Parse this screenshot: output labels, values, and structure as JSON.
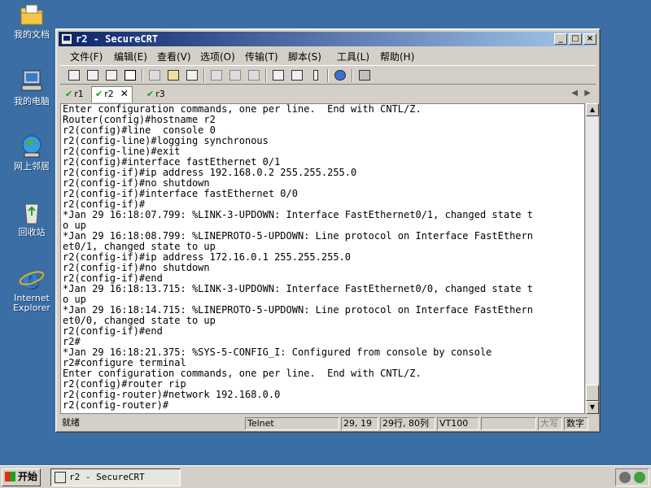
{
  "desktop": {
    "icons": [
      {
        "label": "我的文档"
      },
      {
        "label": "我的电脑"
      },
      {
        "label": "网上邻居"
      },
      {
        "label": "回收站"
      },
      {
        "label": "Internet Explorer"
      }
    ]
  },
  "window": {
    "title": "r2 - SecureCRT",
    "controls": {
      "minimize": "_",
      "maximize": "□",
      "close": "×"
    }
  },
  "menu": [
    "文件(F)",
    "编辑(E)",
    "查看(V)",
    "选项(O)",
    "传输(T)",
    "脚本(S)",
    "工具(L)",
    "帮助(H)"
  ],
  "toolbar": {
    "icons": [
      "connect-icon",
      "quick-connect-icon",
      "connect-in-tab-icon",
      "disconnect-icon",
      "copy-icon",
      "paste-icon",
      "find-icon",
      "print-icon",
      "print-selection-icon",
      "print-setup-icon",
      "session-options-icon",
      "global-options-icon",
      "keymap-icon",
      "help-icon",
      "about-icon"
    ]
  },
  "tabs": [
    {
      "label": "r1",
      "active": false
    },
    {
      "label": "r2",
      "active": true
    },
    {
      "label": "r3",
      "active": false
    }
  ],
  "terminal": {
    "lines": [
      "Enter configuration commands, one per line.  End with CNTL/Z.",
      "Router(config)#hostname r2",
      "r2(config)#line  console 0",
      "r2(config-line)#logging synchronous",
      "r2(config-line)#exit",
      "r2(config)#interface fastEthernet 0/1",
      "r2(config-if)#ip address 192.168.0.2 255.255.255.0",
      "r2(config-if)#no shutdown",
      "r2(config-if)#interface fastEthernet 0/0",
      "r2(config-if)#",
      "*Jan 29 16:18:07.799: %LINK-3-UPDOWN: Interface FastEthernet0/1, changed state t",
      "o up",
      "*Jan 29 16:18:08.799: %LINEPROTO-5-UPDOWN: Line protocol on Interface FastEthern",
      "et0/1, changed state to up",
      "r2(config-if)#ip address 172.16.0.1 255.255.255.0",
      "r2(config-if)#no shutdown",
      "r2(config-if)#end",
      "*Jan 29 16:18:13.715: %LINK-3-UPDOWN: Interface FastEthernet0/0, changed state t",
      "o up",
      "*Jan 29 16:18:14.715: %LINEPROTO-5-UPDOWN: Line protocol on Interface FastEthern",
      "et0/0, changed state to up",
      "r2(config-if)#end",
      "r2#",
      "*Jan 29 16:18:21.375: %SYS-5-CONFIG_I: Configured from console by console",
      "r2#configure terminal",
      "Enter configuration commands, one per line.  End with CNTL/Z.",
      "r2(config)#router rip",
      "r2(config-router)#network 192.168.0.0",
      "r2(config-router)#"
    ]
  },
  "status": {
    "ready": "就绪",
    "protocol": "Telnet",
    "cursor": "29, 19",
    "size": "29行, 80列",
    "emulation": "VT100",
    "caps": "大写",
    "num": "数字"
  },
  "taskbar": {
    "start": "开始",
    "task": "r2 - SecureCRT"
  }
}
